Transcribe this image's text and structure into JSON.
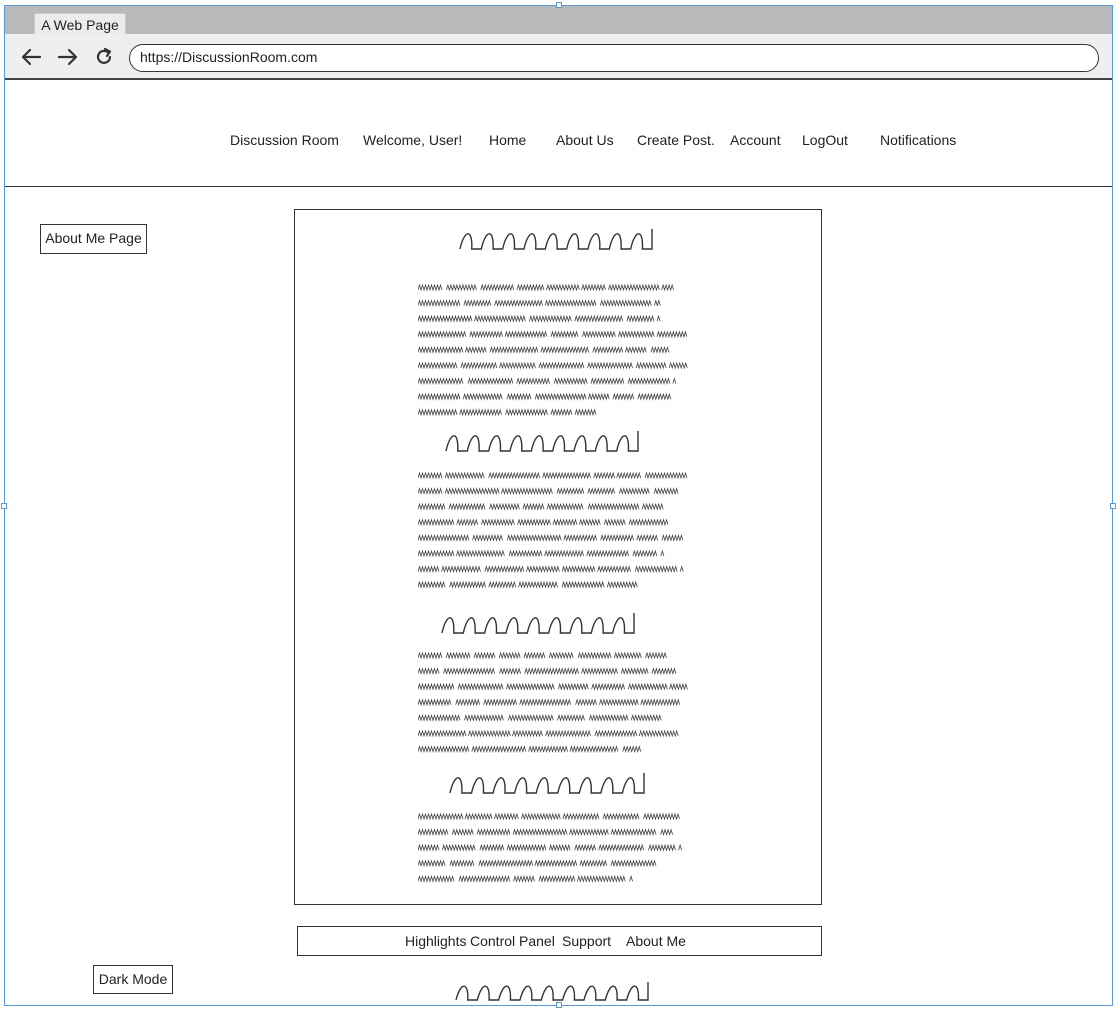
{
  "browser": {
    "tab_title": "A Web Page",
    "url": "https://DiscussionRoom.com",
    "back_icon": "arrow-left-icon",
    "forward_icon": "arrow-right-icon",
    "reload_icon": "reload-icon"
  },
  "nav": {
    "brand": "Discussion Room",
    "welcome": "Welcome, User!",
    "home": "Home",
    "about_us": "About Us",
    "create_post": "Create Post.",
    "account": "Account",
    "logout": "LogOut",
    "notifications": "Notifications"
  },
  "sidebar": {
    "about_me_page": "About Me Page",
    "dark_mode": "Dark Mode"
  },
  "footer": {
    "highlights": "Highlights",
    "control_panel": "Control Panel",
    "support": "Support",
    "about_me": "About Me"
  },
  "colors": {
    "frame_border": "#5b9bd5",
    "tabstrip": "#b9b9b9",
    "toolbar": "#efefef",
    "ink": "#333333"
  }
}
